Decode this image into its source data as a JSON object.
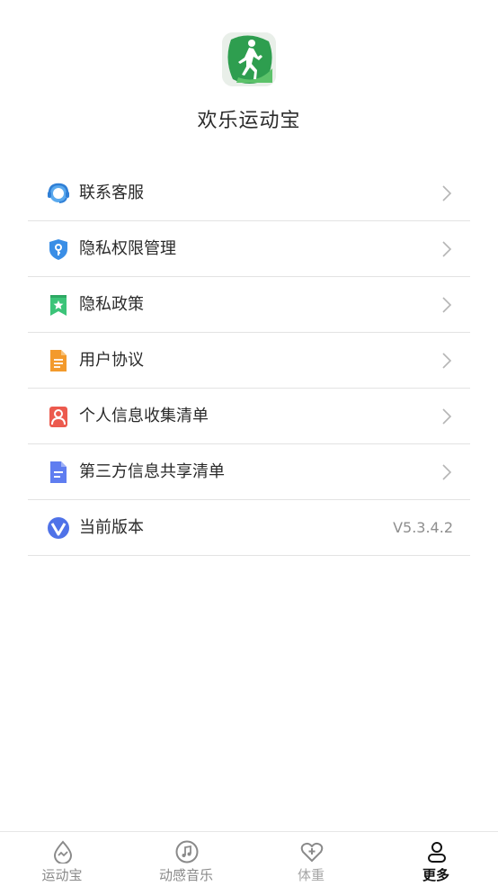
{
  "app": {
    "name": "欢乐运动宝",
    "logo_icon": "runner-icon"
  },
  "menu": [
    {
      "icon": "customer-service-icon",
      "label": "联系客服"
    },
    {
      "icon": "privacy-shield-icon",
      "label": "隐私权限管理"
    },
    {
      "icon": "bookmark-star-icon",
      "label": "隐私政策"
    },
    {
      "icon": "document-icon",
      "label": "用户协议"
    },
    {
      "icon": "person-card-icon",
      "label": "个人信息收集清单"
    },
    {
      "icon": "list-document-icon",
      "label": "第三方信息共享清单"
    },
    {
      "icon": "version-icon",
      "label": "当前版本",
      "value": "V5.3.4.2"
    }
  ],
  "tabbar": {
    "tabs": [
      {
        "label": "运动宝",
        "icon": "drop-icon"
      },
      {
        "label": "动感音乐",
        "icon": "music-icon"
      },
      {
        "label": "体重",
        "icon": "heart-plus-icon"
      },
      {
        "label": "更多",
        "icon": "user-icon"
      }
    ],
    "active_index": 3
  },
  "colors": {
    "brand_green": "#2e9e4f",
    "blue": "#3a8ee6",
    "orange": "#f39a2c",
    "red": "#ec5a4e",
    "indigo": "#5f7df0"
  }
}
